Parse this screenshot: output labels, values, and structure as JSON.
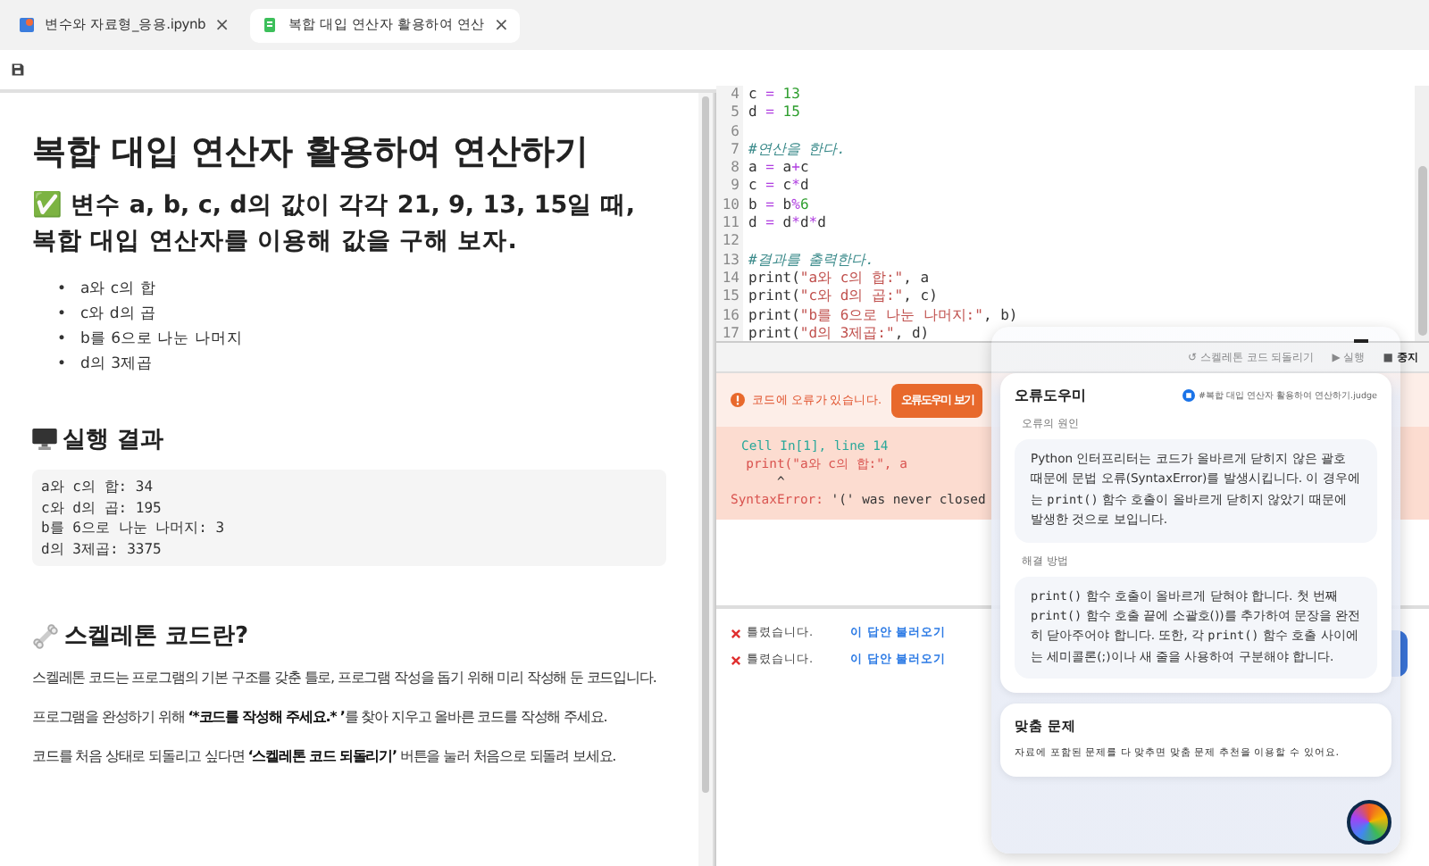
{
  "tabs": [
    {
      "label": "변수와 자료형_응용.ipynb",
      "close": "×",
      "selected": false,
      "kind": "notebook"
    },
    {
      "label": "복합 대입 연산자 활용하여 연산",
      "close": "×",
      "selected": true,
      "kind": "file"
    }
  ],
  "document": {
    "title": "복합 대입 연산자 활용하여 연산하기",
    "task": "✅ 변수 a, b, c, d의 값이 각각 21, 9, 13, 15일 때, 복합 대입 연산자를 이용해 값을 구해 보자.",
    "bullet": "•",
    "items": [
      "a와 c의 합",
      "c와 d의 곱",
      "b를 6으로 나눈 나머지",
      "d의 3제곱"
    ],
    "result_heading": "실행 결과",
    "result_lines": [
      "a와 c의 합: 34",
      "c와 d의 곱: 195",
      "b를 6으로 나눈 나머지: 3",
      "d의 3제곱: 3375"
    ],
    "skeleton_heading": "스켈레톤 코드란?",
    "paragraphs": [
      [
        {
          "text": "스켈레톤 코드는 프로그램의 기본 구조를 갖춘 틀로, 프로그램 작성을 돕기 위해 미리 작성해 둔 코드입니다.",
          "bold": false
        }
      ],
      [
        {
          "text": "프로그램을 완성하기 위해 ",
          "bold": false
        },
        {
          "text": "‘*코드를 작성해 주세요.* ’",
          "bold": true
        },
        {
          "text": "를 찾아 지우고 올바른 코드를 작성해 주세요.",
          "bold": false
        }
      ],
      [
        {
          "text": "코드를 처음 상태로 되돌리고 싶다면 ",
          "bold": false
        },
        {
          "text": "‘스켈레톤 코드 되돌리기’",
          "bold": true
        },
        {
          "text": " 버튼을 눌러 처음으로 되돌려 보세요.",
          "bold": false
        }
      ]
    ]
  },
  "editor": {
    "lines": [
      {
        "number": "4",
        "tokens": [
          {
            "kind": "plain",
            "text": "c "
          },
          {
            "kind": "op",
            "text": "="
          },
          {
            "kind": "num",
            "text": " 13"
          }
        ]
      },
      {
        "number": "5",
        "tokens": [
          {
            "kind": "plain",
            "text": "d "
          },
          {
            "kind": "op",
            "text": "="
          },
          {
            "kind": "num",
            "text": " 15"
          }
        ]
      },
      {
        "number": "6"
      },
      {
        "number": "7",
        "tokens": [
          {
            "kind": "comment",
            "text": "#연산을 한다."
          }
        ]
      },
      {
        "number": "8",
        "tokens": [
          {
            "kind": "plain",
            "text": "a "
          },
          {
            "kind": "op",
            "text": "="
          },
          {
            "kind": "plain",
            "text": " a"
          },
          {
            "kind": "op",
            "text": "+"
          },
          {
            "kind": "plain",
            "text": "c"
          }
        ]
      },
      {
        "number": "9",
        "tokens": [
          {
            "kind": "plain",
            "text": "c "
          },
          {
            "kind": "op",
            "text": "="
          },
          {
            "kind": "plain",
            "text": " c"
          },
          {
            "kind": "op",
            "text": "*"
          },
          {
            "kind": "plain",
            "text": "d"
          }
        ]
      },
      {
        "number": "10",
        "tokens": [
          {
            "kind": "plain",
            "text": "b "
          },
          {
            "kind": "op",
            "text": "="
          },
          {
            "kind": "plain",
            "text": " b"
          },
          {
            "kind": "op",
            "text": "%"
          },
          {
            "kind": "num",
            "text": "6"
          }
        ]
      },
      {
        "number": "11",
        "tokens": [
          {
            "kind": "plain",
            "text": "d "
          },
          {
            "kind": "op",
            "text": "="
          },
          {
            "kind": "plain",
            "text": " d"
          },
          {
            "kind": "op",
            "text": "*"
          },
          {
            "kind": "plain",
            "text": "d"
          },
          {
            "kind": "op",
            "text": "*"
          },
          {
            "kind": "plain",
            "text": "d"
          }
        ]
      },
      {
        "number": "12"
      },
      {
        "number": "13",
        "tokens": [
          {
            "kind": "comment",
            "text": "#결과를 출력한다."
          }
        ]
      },
      {
        "number": "14",
        "tokens": [
          {
            "kind": "plain",
            "text": "print("
          },
          {
            "kind": "str",
            "text": "\"a와 c의 합:\""
          },
          {
            "kind": "plain",
            "text": ", a"
          }
        ]
      },
      {
        "number": "15",
        "tokens": [
          {
            "kind": "plain",
            "text": "print("
          },
          {
            "kind": "str",
            "text": "\"c와 d의 곱:\""
          },
          {
            "kind": "plain",
            "text": ", c)"
          }
        ]
      },
      {
        "number": "16",
        "tokens": [
          {
            "kind": "plain",
            "text": "print("
          },
          {
            "kind": "str",
            "text": "\"b를 6으로 나눈 나머지:\""
          },
          {
            "kind": "plain",
            "text": ", b)"
          }
        ]
      },
      {
        "number": "17",
        "tokens": [
          {
            "kind": "plain",
            "text": "print("
          },
          {
            "kind": "str",
            "text": "\"d의 3제곱:\""
          },
          {
            "kind": "plain",
            "text": ", d)"
          }
        ]
      }
    ]
  },
  "toolbar": [
    {
      "icon": "↺",
      "label": "스켈레톤 코드 되돌리기",
      "kind": "reset"
    },
    {
      "icon": "▶",
      "label": "실행",
      "kind": "run"
    },
    {
      "icon": "■",
      "label": "중지",
      "kind": "stop"
    }
  ],
  "error_banner": {
    "message": "코드에 오류가 있습니다.",
    "button": "오류도우미 보기"
  },
  "error_output": {
    "location": "Cell In[1], line 14",
    "code": "  print(\"a와 c의 합:\", a",
    "caret": "      ^",
    "error_type": "SyntaxError:",
    "error_message": " '(' was never closed"
  },
  "submissions": [
    {
      "status": "틀렸습니다.",
      "link": "이 답안 불러오기"
    },
    {
      "status": "틀렸습니다.",
      "link": "이 답안 불러오기"
    }
  ],
  "assistant": {
    "title": "오류도우미",
    "source": "#복합 대입 연산자 활용하여 연산하기.judge",
    "cause_label": "오류의 원인",
    "cause": [
      {
        "text": "Python 인터프리터는 코드가 올바르게 닫히지 않은 괄호 때문에 문법 오류(SyntaxError)를 발생시킵니다. 이 경우에는 ",
        "code": false
      },
      {
        "text": "print()",
        "code": true
      },
      {
        "text": " 함수 호출이 올바르게 닫히지 않았기 때문에 발생한 것으로 보입니다.",
        "code": false
      }
    ],
    "fix_label": "해결 방법",
    "fix": [
      {
        "text": "print()",
        "code": true
      },
      {
        "text": " 함수 호출이 올바르게 닫혀야 합니다. 첫 번째 ",
        "code": false
      },
      {
        "text": "print()",
        "code": true
      },
      {
        "text": " 함수 호출 끝에 소괄호())를 추가하여 문장을 완전히 닫아주어야 합니다. 또한, 각 ",
        "code": false
      },
      {
        "text": "print()",
        "code": true
      },
      {
        "text": " 함수 호출 사이에는 세미콜론(;)이나 새 줄을 사용하여 구분해야 합니다.",
        "code": false
      }
    ],
    "custom_title": "맞춤 문제",
    "custom_text": "자료에 포함된 문제를 다 맞추면 맞춤 문제 추천을 이용할 수 있어요."
  }
}
